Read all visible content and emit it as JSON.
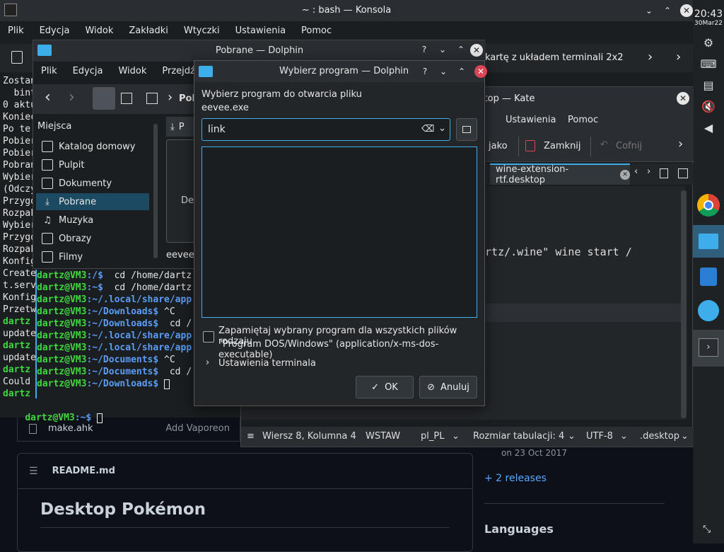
{
  "konsole": {
    "title": "~ : bash — Konsola",
    "menu": [
      "Plik",
      "Edycja",
      "Widok",
      "Zakładki",
      "Wtyczki",
      "Ustawienia",
      "Pomoc"
    ],
    "tab_label": "kartę z układem terminali 2x2",
    "left_lines": [
      "Zostan",
      "  bint",
      "0 aktu",
      "Koniec",
      "Po te",
      "Pobier",
      "Pobier",
      "Pobran",
      "Wybier",
      "(Odczy",
      "Przygo",
      "Rozpak",
      "Wybier",
      "Przygo",
      "Rozpak",
      "Konfig",
      "Create",
      "t.serv",
      "Konfig",
      "Przetw",
      "dartz",
      "update",
      "dartz",
      "update",
      "dartz",
      "Could",
      "dartz"
    ],
    "bottom_prompt_user": "dartz@VM3",
    "bottom_prompt_path": ":~$"
  },
  "clock": {
    "time": "20:43",
    "date": "30Mar22"
  },
  "dolphin": {
    "title": "Pobrane — Dolphin",
    "menu": [
      "Plik",
      "Edycja",
      "Widok",
      "Przejdź"
    ],
    "breadcrumb": "Pob",
    "places_header": "Miejsca",
    "places": [
      "Katalog domowy",
      "Pulpit",
      "Dokumenty",
      "Pobrane",
      "Muzyka",
      "Obrazy",
      "Filmy"
    ],
    "selected_place_index": 3,
    "tab_partial": "P",
    "file_partial": "Des",
    "file_name": "eevee."
  },
  "terminal_split": {
    "lines": [
      {
        "user": "dartz@VM3",
        "path": ":/$",
        "cmd": "  cd /home/dartz"
      },
      {
        "user": "dartz@VM3",
        "path": ":~$",
        "cmd": "  cd /home/dartz"
      },
      {
        "user": "dartz@VM3",
        "path": ":~/.local/share/app",
        "cmd": ""
      },
      {
        "user": "dartz@VM3",
        "path": ":~/Downloads$",
        "cmd": " ^C"
      },
      {
        "user": "dartz@VM3",
        "path": ":~/Downloads$",
        "cmd": "  cd /"
      },
      {
        "user": "dartz@VM3",
        "path": ":~/.local/share/app",
        "cmd": ""
      },
      {
        "user": "dartz@VM3",
        "path": ":~/.local/share/app",
        "cmd": ""
      },
      {
        "user": "dartz@VM3",
        "path": ":~/Documents$",
        "cmd": " ^C"
      },
      {
        "user": "dartz@VM3",
        "path": ":~/Documents$",
        "cmd": "  cd /"
      },
      {
        "user": "dartz@VM3",
        "path": ":~/Downloads$",
        "cmd": " "
      }
    ]
  },
  "kate": {
    "title_partial": "ktop — Kate",
    "menu": [
      "Ustawienia",
      "Pomoc"
    ],
    "toolbar_partial": "jako",
    "close_label": "Zamknij",
    "undo_label": "Cofnij",
    "tab_label": "wine-extension-rtf.desktop",
    "code_partial": "artz/.wine\" wine start /",
    "status": {
      "position": "Wiersz 8, Kolumna 4",
      "mode": "WSTAW",
      "lang": "pl_PL",
      "tab": "Rozmiar tabulacji: 4",
      "encoding": "UTF-8",
      "type": ".desktop"
    }
  },
  "dialog": {
    "title": "Wybierz program — Dolphin",
    "prompt": "Wybierz program do otwarcia pliku",
    "filename": "eevee.exe",
    "search_value": "link",
    "checkbox_label_1": "Zapamiętaj wybrany program dla wszystkich plików rodzaju",
    "checkbox_label_2": "\"Program DOS/Windows\" (application/x-ms-dos-executable)",
    "terminal_settings": "Ustawienia terminala",
    "ok_label": "OK",
    "cancel_label": "Anuluj"
  },
  "github": {
    "file_name": "make.ahk",
    "commit_msg": "Add Vaporeon",
    "readme_label": "README.md",
    "heading": "Desktop Pokémon",
    "release_date": "on 23 Oct 2017",
    "releases_link": "+ 2 releases",
    "languages": "Languages"
  },
  "colors": {
    "accent": "#3daee9",
    "selection": "#1d4a63",
    "close_red": "#da4453",
    "prompt_green": "#3fd63f",
    "prompt_blue": "#5b9cf5"
  }
}
